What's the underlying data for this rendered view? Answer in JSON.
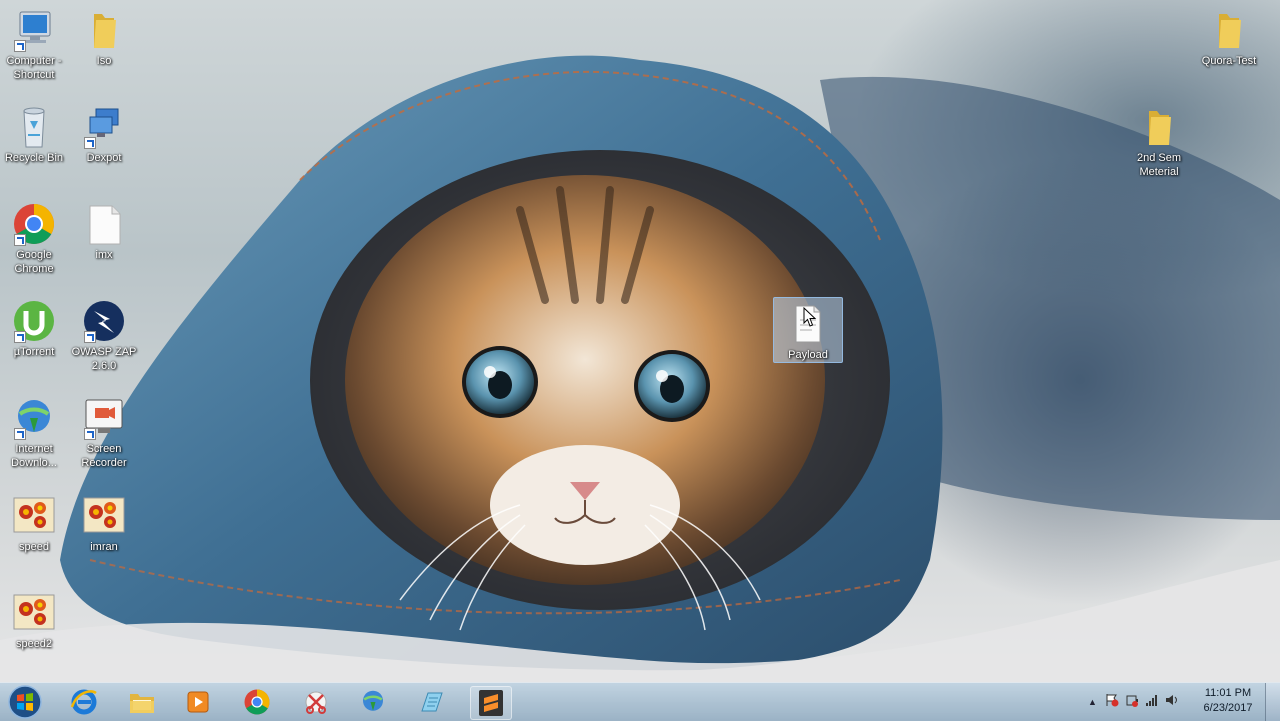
{
  "desktop": {
    "left_icons": [
      {
        "label": "Computer - Shortcut",
        "icon": "computer-icon"
      },
      {
        "label": "Iso",
        "icon": "folder-icon"
      },
      {
        "label": "Recycle Bin",
        "icon": "recycle-bin-icon"
      },
      {
        "label": "Dexpot",
        "icon": "dexpot-icon"
      },
      {
        "label": "Google Chrome",
        "icon": "chrome-icon"
      },
      {
        "label": "imx",
        "icon": "file-icon"
      },
      {
        "label": "µTorrent",
        "icon": "utorrent-icon"
      },
      {
        "label": "OWASP ZAP 2.6.0",
        "icon": "owasp-zap-icon"
      },
      {
        "label": "Internet Downlo...",
        "icon": "internet-download-manager-icon"
      },
      {
        "label": "Screen Recorder",
        "icon": "screen-recorder-icon"
      },
      {
        "label": "speed",
        "icon": "flower-icon"
      },
      {
        "label": "imran",
        "icon": "flower-icon"
      },
      {
        "label": "speed2",
        "icon": "flower-icon"
      }
    ],
    "right_icons": [
      {
        "label": "Quora-Test",
        "icon": "folder-icon"
      },
      {
        "label": "2nd Sem Meterial",
        "icon": "folder-icon"
      }
    ],
    "selected_icon": {
      "label": "Payload",
      "icon": "file-icon"
    }
  },
  "taskbar": {
    "pinned": [
      {
        "name": "internet-explorer-icon"
      },
      {
        "name": "windows-explorer-icon"
      },
      {
        "name": "media-player-icon"
      },
      {
        "name": "chrome-icon"
      },
      {
        "name": "snipping-tool-icon"
      },
      {
        "name": "internet-download-manager-icon"
      },
      {
        "name": "text-editor-icon"
      },
      {
        "name": "sublime-text-icon"
      }
    ],
    "tray": {
      "time": "11:01 PM",
      "date": "6/23/2017"
    }
  },
  "colors": {
    "folder": "#e9c34a",
    "taskbar": "#aec3d3",
    "chrome_red": "#db4437",
    "chrome_green": "#0f9d58",
    "chrome_yellow": "#f4b400",
    "chrome_blue": "#4285f4"
  }
}
